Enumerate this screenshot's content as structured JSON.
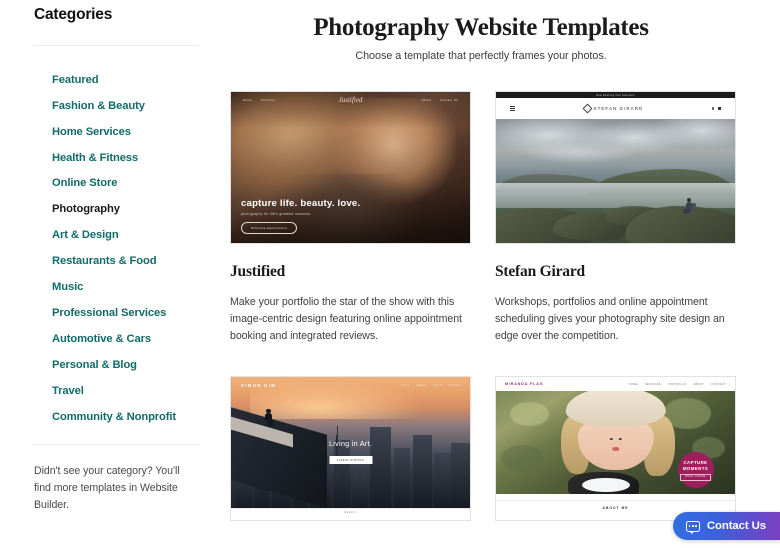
{
  "sidebar": {
    "title": "Categories",
    "items": [
      {
        "label": "Featured",
        "active": false
      },
      {
        "label": "Fashion & Beauty",
        "active": false
      },
      {
        "label": "Home Services",
        "active": false
      },
      {
        "label": "Health & Fitness",
        "active": false
      },
      {
        "label": "Online Store",
        "active": false
      },
      {
        "label": "Photography",
        "active": true
      },
      {
        "label": "Art & Design",
        "active": false
      },
      {
        "label": "Restaurants & Food",
        "active": false
      },
      {
        "label": "Music",
        "active": false
      },
      {
        "label": "Professional Services",
        "active": false
      },
      {
        "label": "Automotive & Cars",
        "active": false
      },
      {
        "label": "Personal & Blog",
        "active": false
      },
      {
        "label": "Travel",
        "active": false
      },
      {
        "label": "Community & Nonprofit",
        "active": false
      }
    ],
    "note": "Didn't see your category? You'll find more templates in Website Builder."
  },
  "header": {
    "title": "Photography Website Templates",
    "subtitle": "Choose a template that perfectly frames your photos."
  },
  "templates": [
    {
      "name": "Justified",
      "description": "Make your portfolio the star of the show with this image-centric design featuring online appointment booking and integrated reviews.",
      "preview": {
        "brand": "Justified",
        "nav_left": [
          "Home",
          "Portfolio"
        ],
        "nav_right": [
          "About",
          "Contact Us"
        ],
        "headline": "capture life. beauty. love.",
        "subhead": "photography for life's greatest moments",
        "button": "Schedule Appointment"
      }
    },
    {
      "name": "Stefan Girard",
      "description": "Workshops, portfolios and online appointment scheduling gives your photography site design an edge over the competition.",
      "preview": {
        "announcement": "Now Booking Fall Sessions",
        "brand": "STEFAN GIRARD"
      }
    },
    {
      "name": "Simon Kim",
      "description": "",
      "preview": {
        "brand": "SIMON KIM",
        "nav_right": [
          "Home",
          "Gallery",
          "About",
          "Contact"
        ],
        "headline": "Living in Art.",
        "button": "LATEST PHOTOS",
        "section": "Gallery"
      }
    },
    {
      "name": "Miranda Flag",
      "description": "",
      "preview": {
        "brand": "MIRANDA FLAG",
        "nav": [
          "HOME",
          "SERVICES",
          "PORTFOLIO",
          "ABOUT",
          "CONTACT"
        ],
        "badge_line1": "CAPTURE",
        "badge_line2": "MOMENTS",
        "badge_button": "BOOK ONLINE",
        "section": "ABOUT ME"
      }
    }
  ],
  "contact": {
    "label": "Contact Us"
  },
  "colors": {
    "link_teal": "#106b69",
    "badge_magenta": "#9e1f5c",
    "contact_blue": "#2f6fe0",
    "contact_purple": "#7a3fc2"
  }
}
